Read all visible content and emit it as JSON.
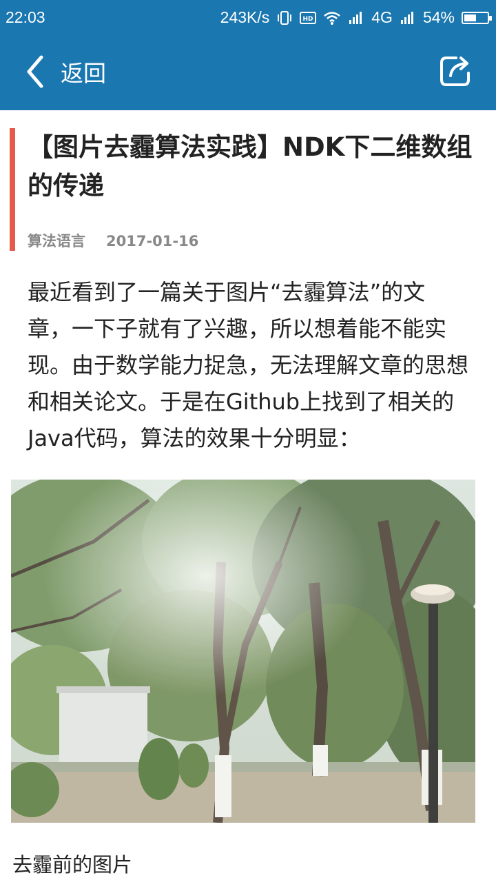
{
  "status_bar": {
    "time": "22:03",
    "net_speed": "243K/s",
    "network_type": "4G",
    "battery_percent": "54%",
    "battery_level": 0.54,
    "icons": [
      "vibrate-icon",
      "hd-icon",
      "wifi-icon",
      "signal-icon",
      "signal-icon",
      "battery-icon"
    ]
  },
  "app_bar": {
    "back_label": "返回",
    "back_icon": "chevron-left-icon",
    "share_icon": "share-icon",
    "background_color": "#1a77b0"
  },
  "article": {
    "title": "【图片去霾算法实践】NDK下二维数组的传递",
    "category": "算法语言",
    "date": "2017-01-16",
    "accent_color": "#e65a4c",
    "paragraph": "最近看到了一篇关于图片“去霾算法”的文章，一下子就有了兴趣，所以想着能不能实现。由于数学能力捉急，无法理解文章的思想和相关论文。于是在Github上找到了相关的Java代码，算法的效果十分明显：",
    "image_caption": "去霾前的图片"
  }
}
